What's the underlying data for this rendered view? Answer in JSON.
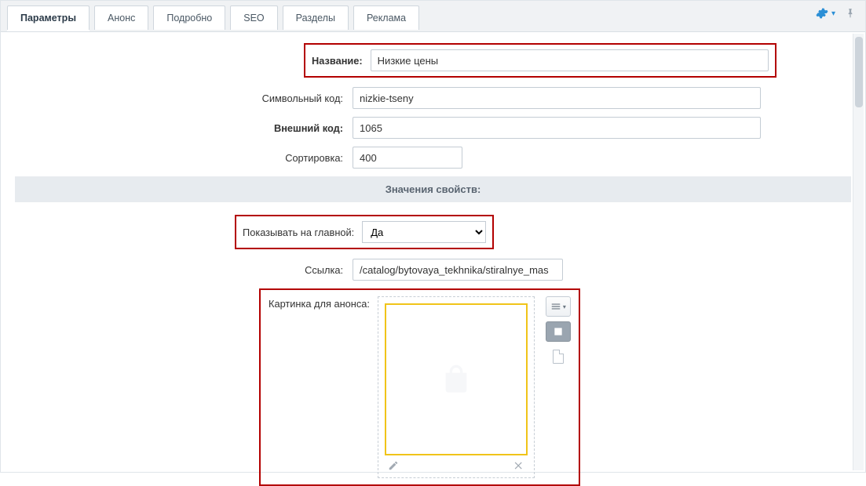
{
  "tabs": [
    {
      "label": "Параметры",
      "active": true
    },
    {
      "label": "Анонс"
    },
    {
      "label": "Подробно"
    },
    {
      "label": "SEO"
    },
    {
      "label": "Разделы"
    },
    {
      "label": "Реклама"
    }
  ],
  "fields": {
    "name": {
      "label": "Название:",
      "value": "Низкие цены"
    },
    "code": {
      "label": "Символьный код:",
      "value": "nizkie-tseny"
    },
    "xml_id": {
      "label": "Внешний код:",
      "value": "1065"
    },
    "sort": {
      "label": "Сортировка:",
      "value": "400"
    }
  },
  "section_header": "Значения свойств:",
  "props": {
    "show_home": {
      "label": "Показывать на главной:",
      "value": "Да"
    },
    "link": {
      "label": "Ссылка:",
      "value": "/catalog/bytovaya_tekhnika/stiralnye_mas"
    },
    "preview_pic": {
      "label": "Картинка для анонса:"
    }
  },
  "icons": {
    "gear": "gear-icon",
    "pin": "pin-icon",
    "menu": "menu-icon",
    "image": "image-icon",
    "file": "file-icon",
    "edit": "pencil-icon",
    "close": "close-icon"
  },
  "colors": {
    "highlight": "#b30000",
    "thumb_border": "#f0c419",
    "accent": "#2b8fd6"
  }
}
